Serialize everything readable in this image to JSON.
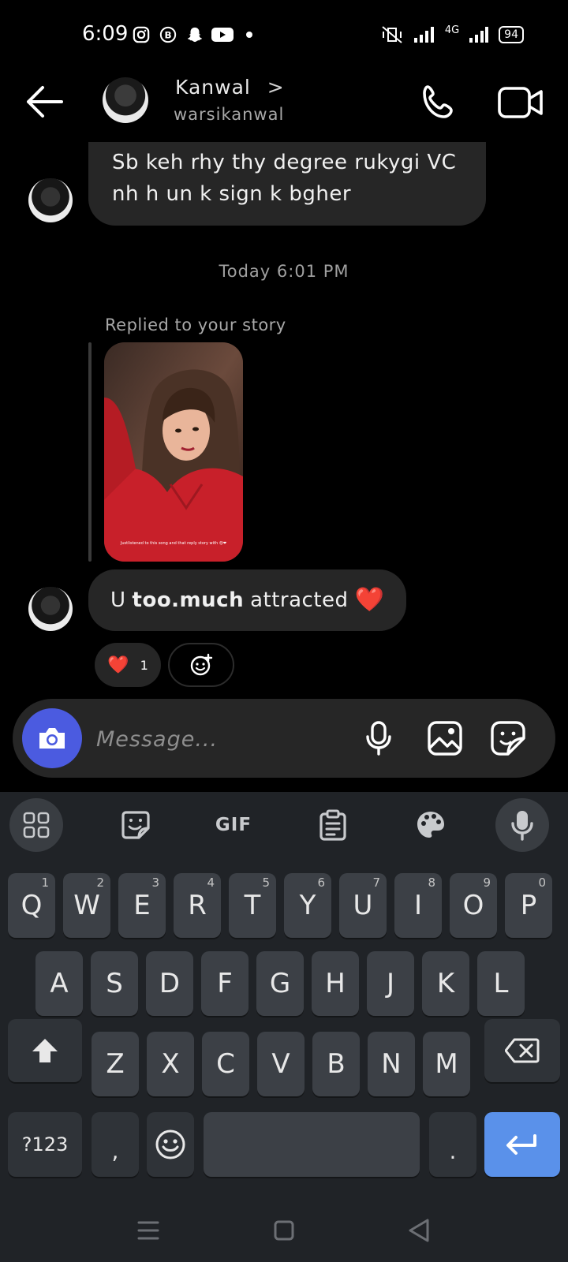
{
  "status_bar": {
    "time": "6:09",
    "network": "4G",
    "battery": "94"
  },
  "header": {
    "name": "Kanwal",
    "chevron": ">",
    "username": "warsikanwal"
  },
  "messages": {
    "first_message": "Sb keh rhy thy degree rukygi VC nh h un k sign k bgher",
    "timestamp": "Today 6:01 PM",
    "reply_label": "Replied to your story",
    "story_caption": "Justlistened to this song and that reply story with 😍❤",
    "second_message_pre": "U",
    "second_message_bold": "too.much",
    "second_message_post": "attracted",
    "second_message_emoji": "❤️",
    "reaction_emoji": "❤️",
    "reaction_count": "1"
  },
  "composer": {
    "placeholder": "Message..."
  },
  "keyboard": {
    "toolbar_gif": "GIF",
    "row1": [
      {
        "key": "Q",
        "hint": "1"
      },
      {
        "key": "W",
        "hint": "2"
      },
      {
        "key": "E",
        "hint": "3"
      },
      {
        "key": "R",
        "hint": "4"
      },
      {
        "key": "T",
        "hint": "5"
      },
      {
        "key": "Y",
        "hint": "6"
      },
      {
        "key": "U",
        "hint": "7"
      },
      {
        "key": "I",
        "hint": "8"
      },
      {
        "key": "O",
        "hint": "9"
      },
      {
        "key": "P",
        "hint": "0"
      }
    ],
    "row2": [
      "A",
      "S",
      "D",
      "F",
      "G",
      "H",
      "J",
      "K",
      "L"
    ],
    "row3": [
      "Z",
      "X",
      "C",
      "V",
      "B",
      "N",
      "M"
    ],
    "symbols_label": "?123",
    "comma": ",",
    "period": "."
  },
  "colors": {
    "accent_camera": "#4b5be0",
    "enter_key": "#5a91ea",
    "heart": "#e8202e"
  }
}
